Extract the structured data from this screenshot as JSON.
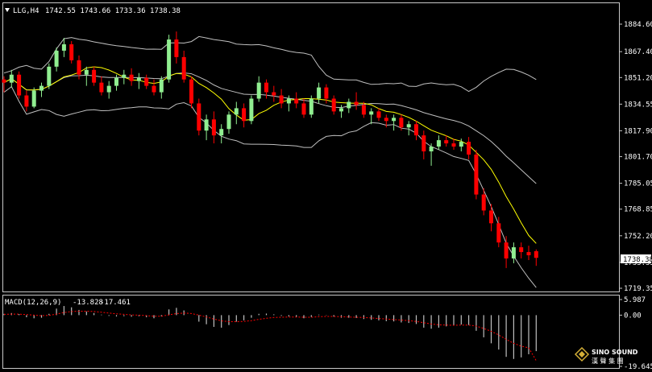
{
  "chart_data": [
    {
      "type": "candlestick",
      "panel": "price",
      "symbol_label": "LLG,H4",
      "ohlc_text": "1742.55 1743.66 1733.36 1738.38",
      "current_price": "1738.38",
      "yticks": [
        "1884.60",
        "1867.40",
        "1851.20",
        "1834.55",
        "1817.90",
        "1801.70",
        "1785.05",
        "1768.85",
        "1752.20",
        "1735.55",
        "1719.35"
      ],
      "ylim": [
        1719.35,
        1884.6
      ],
      "indicators": [
        "Bollinger Bands",
        "Moving average"
      ],
      "colors": {
        "bull": "#90ee90",
        "bear": "#ff0000",
        "ma": "#ffff00",
        "bands": "#c0c0c0",
        "background": "#000000"
      },
      "candles": [
        [
          1850,
          1852,
          1842,
          1848
        ],
        [
          1848,
          1856,
          1845,
          1853
        ],
        [
          1853,
          1855,
          1838,
          1840
        ],
        [
          1840,
          1843,
          1830,
          1833
        ],
        [
          1833,
          1845,
          1832,
          1843
        ],
        [
          1843,
          1848,
          1839,
          1846
        ],
        [
          1846,
          1860,
          1844,
          1858
        ],
        [
          1858,
          1870,
          1855,
          1868
        ],
        [
          1868,
          1876,
          1864,
          1872
        ],
        [
          1872,
          1874,
          1860,
          1862
        ],
        [
          1862,
          1865,
          1850,
          1853
        ],
        [
          1853,
          1858,
          1846,
          1856
        ],
        [
          1856,
          1858,
          1846,
          1848
        ],
        [
          1848,
          1852,
          1840,
          1842
        ],
        [
          1842,
          1849,
          1838,
          1846
        ],
        [
          1846,
          1853,
          1843,
          1851
        ],
        [
          1851,
          1856,
          1847,
          1853
        ],
        [
          1853,
          1857,
          1846,
          1849
        ],
        [
          1849,
          1854,
          1844,
          1851
        ],
        [
          1851,
          1853,
          1844,
          1846
        ],
        [
          1846,
          1850,
          1840,
          1842
        ],
        [
          1842,
          1852,
          1838,
          1850
        ],
        [
          1850,
          1878,
          1848,
          1875
        ],
        [
          1875,
          1880,
          1860,
          1864
        ],
        [
          1864,
          1868,
          1848,
          1850
        ],
        [
          1850,
          1852,
          1832,
          1835
        ],
        [
          1835,
          1838,
          1815,
          1818
        ],
        [
          1818,
          1828,
          1812,
          1825
        ],
        [
          1825,
          1830,
          1810,
          1815
        ],
        [
          1815,
          1822,
          1810,
          1819
        ],
        [
          1819,
          1830,
          1816,
          1828
        ],
        [
          1828,
          1836,
          1822,
          1832
        ],
        [
          1832,
          1835,
          1820,
          1824
        ],
        [
          1824,
          1840,
          1822,
          1838
        ],
        [
          1838,
          1852,
          1836,
          1848
        ],
        [
          1848,
          1850,
          1838,
          1842
        ],
        [
          1842,
          1846,
          1836,
          1840
        ],
        [
          1840,
          1844,
          1832,
          1835
        ],
        [
          1835,
          1840,
          1830,
          1838
        ],
        [
          1838,
          1842,
          1832,
          1835
        ],
        [
          1835,
          1838,
          1826,
          1828
        ],
        [
          1828,
          1840,
          1826,
          1838
        ],
        [
          1838,
          1848,
          1835,
          1845
        ],
        [
          1845,
          1847,
          1835,
          1838
        ],
        [
          1838,
          1840,
          1828,
          1830
        ],
        [
          1830,
          1834,
          1826,
          1832
        ],
        [
          1832,
          1838,
          1829,
          1836
        ],
        [
          1836,
          1842,
          1831,
          1834
        ],
        [
          1834,
          1836,
          1826,
          1828
        ],
        [
          1828,
          1832,
          1822,
          1830
        ],
        [
          1830,
          1832,
          1824,
          1826
        ],
        [
          1826,
          1828,
          1820,
          1824
        ],
        [
          1824,
          1828,
          1818,
          1826
        ],
        [
          1826,
          1828,
          1818,
          1820
        ],
        [
          1820,
          1824,
          1815,
          1822
        ],
        [
          1822,
          1824,
          1812,
          1815
        ],
        [
          1815,
          1818,
          1800,
          1805
        ],
        [
          1805,
          1810,
          1796,
          1808
        ],
        [
          1808,
          1815,
          1806,
          1812
        ],
        [
          1812,
          1815,
          1808,
          1810
        ],
        [
          1810,
          1813,
          1806,
          1808
        ],
        [
          1808,
          1813,
          1805,
          1811
        ],
        [
          1811,
          1814,
          1800,
          1803
        ],
        [
          1803,
          1806,
          1775,
          1778
        ],
        [
          1778,
          1782,
          1765,
          1768
        ],
        [
          1768,
          1772,
          1755,
          1760
        ],
        [
          1760,
          1764,
          1745,
          1748
        ],
        [
          1748,
          1752,
          1732,
          1738
        ],
        [
          1738,
          1748,
          1735,
          1745
        ],
        [
          1745,
          1748,
          1738,
          1742
        ],
        [
          1742,
          1746,
          1737,
          1740
        ],
        [
          1742.55,
          1743.66,
          1733.36,
          1738.38
        ]
      ]
    },
    {
      "type": "histogram",
      "panel": "macd",
      "label": "MACD(12,26,9)",
      "macd_value": "-13.828",
      "signal_value": "-17.461",
      "yticks": [
        "5.987",
        "0.00",
        "-19.645"
      ],
      "ylim": [
        -19.645,
        5.987
      ],
      "colors": {
        "histogram": "#c0c0c0",
        "signal": "#ff0000"
      },
      "macd": [
        0.5,
        0.8,
        0.4,
        -0.8,
        -1.2,
        -1.0,
        0.5,
        2.5,
        3.5,
        3.0,
        2.0,
        1.4,
        0.8,
        0.2,
        -0.3,
        -0.5,
        -0.4,
        -0.6,
        -0.4,
        -0.8,
        -1.2,
        -0.5,
        2.2,
        2.8,
        1.8,
        0.0,
        -2.5,
        -3.5,
        -4.5,
        -4.8,
        -3.8,
        -2.5,
        -2.0,
        -1.0,
        0.5,
        0.6,
        0.3,
        -0.3,
        -0.5,
        -0.8,
        -1.2,
        -0.7,
        0.2,
        0.1,
        -0.6,
        -1.0,
        -1.0,
        -1.1,
        -1.5,
        -1.8,
        -2.0,
        -2.3,
        -2.4,
        -2.8,
        -3.0,
        -3.4,
        -4.8,
        -5.2,
        -4.8,
        -4.3,
        -4.0,
        -3.6,
        -3.8,
        -6.0,
        -8.5,
        -10.8,
        -13.2,
        -16.0,
        -16.8,
        -16.2,
        -15.0,
        -13.8
      ],
      "signal": [
        0.3,
        0.4,
        0.4,
        0.2,
        0.0,
        -0.2,
        -0.1,
        0.4,
        1.0,
        1.4,
        1.5,
        1.5,
        1.4,
        1.1,
        0.8,
        0.5,
        0.3,
        0.1,
        0.0,
        -0.2,
        -0.4,
        -0.4,
        0.1,
        0.6,
        0.8,
        0.6,
        0.0,
        -0.7,
        -1.5,
        -2.2,
        -2.5,
        -2.5,
        -2.4,
        -2.1,
        -1.6,
        -1.2,
        -0.9,
        -0.8,
        -0.7,
        -0.7,
        -0.8,
        -0.8,
        -0.6,
        -0.5,
        -0.5,
        -0.6,
        -0.7,
        -0.8,
        -0.9,
        -1.1,
        -1.3,
        -1.5,
        -1.7,
        -1.9,
        -2.1,
        -2.4,
        -2.9,
        -3.4,
        -3.7,
        -3.8,
        -3.9,
        -3.8,
        -3.8,
        -4.2,
        -5.1,
        -6.2,
        -7.6,
        -9.3,
        -10.8,
        -11.9,
        -12.5,
        -17.461
      ]
    }
  ],
  "logo": {
    "name": "SINO SOUND",
    "subtitle": "漢 聲 集 團"
  }
}
